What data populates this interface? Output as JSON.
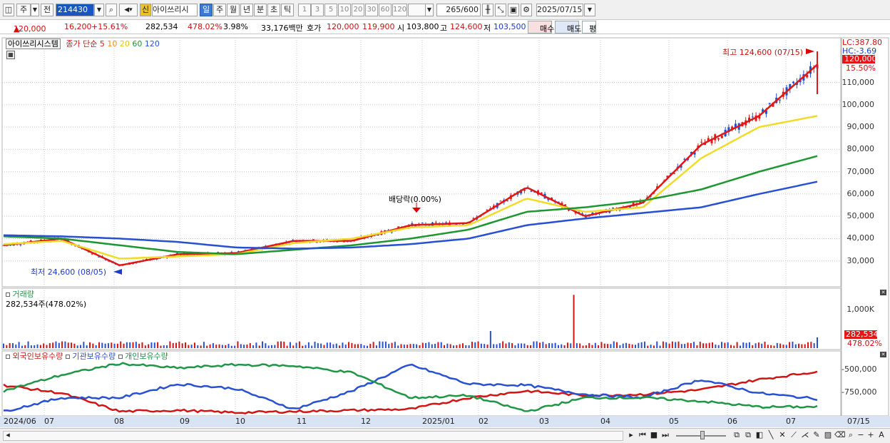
{
  "toolbar": {
    "market_label": "주",
    "prev_label": "전",
    "stock_code": "214430",
    "new_badge": "신",
    "stock_name": "아이쓰리시",
    "period_buttons": [
      "일",
      "주",
      "월",
      "년",
      "분",
      "초",
      "틱"
    ],
    "active_period": "일",
    "interval_numbers": [
      "1",
      "3",
      "5",
      "10",
      "20",
      "30",
      "60",
      "120"
    ],
    "count_value": "265",
    "count_max": "/600",
    "date_value": "2025/07/15"
  },
  "info": {
    "price": "120,000",
    "change_arrow": "▲",
    "change": "16,200",
    "change_pct": "+15.61%",
    "volume": "282,534",
    "volume_ratio": "478.02%",
    "turnover": "3.98%",
    "amount": "33,176백만",
    "bid_label": "호가",
    "bid1": "120,000",
    "bid2": "119,900",
    "open_label": "시",
    "open": "103,800",
    "high_label": "고",
    "high": "124,600",
    "low_label": "저",
    "low": "103,500",
    "buy_button": "매수",
    "sell_button": "매도",
    "eval_button": "평"
  },
  "price_panel": {
    "stock_tag": "아이쓰리시스템",
    "ma_label": "종가 단순",
    "ma_periods": [
      "5",
      "10",
      "20",
      "60",
      "120"
    ],
    "ma_colors": [
      "#e01818",
      "#f08c1e",
      "#f0dc28",
      "#1e9632",
      "#2850d2"
    ],
    "max_label": "최고 124,600 (07/15)",
    "min_label": "최저 24,600 (08/05)",
    "dividend_label": "배당락(0.00%)",
    "lc_label": "LC:387.80",
    "hc_label": "HC:-3.69",
    "current_price_tag": "120,000",
    "current_pct_tag": "15.50%",
    "y_ticks": [
      "110,000",
      "100,000",
      "90,000",
      "80,000",
      "70,000",
      "60,000",
      "50,000",
      "40,000",
      "30,000"
    ]
  },
  "volume_panel": {
    "title": "거래량",
    "value_label": "282,534주(478.02%)",
    "y_tick": "1,000K",
    "current_tag": "282,534",
    "current_pct": "478.02%"
  },
  "holdings_panel": {
    "series_labels": [
      "외국인보유수량",
      "기관보유수량",
      "개인보유수량"
    ],
    "series_colors": [
      "#d21414",
      "#2850d2",
      "#1e9646"
    ],
    "y_ticks": [
      "-500,000",
      "-750,000"
    ]
  },
  "x_axis": {
    "labels": [
      "2024/06",
      "07",
      "08",
      "09",
      "10",
      "11",
      "12",
      "2025/01",
      "02",
      "03",
      "04",
      "05",
      "06",
      "07",
      "07/15"
    ]
  },
  "chart_data": {
    "type": "line",
    "title": "",
    "x": [
      "2024/06",
      "2024/07",
      "2024/08",
      "2024/09",
      "2024/10",
      "2024/11",
      "2024/12",
      "2025/01",
      "2025/02",
      "2025/03",
      "2025/04",
      "2025/05",
      "2025/06",
      "2025/07",
      "2025/07/15"
    ],
    "series": [
      {
        "name": "5",
        "values": [
          37000,
          40000,
          28000,
          33000,
          33500,
          39000,
          39000,
          46000,
          47000,
          63000,
          50000,
          56000,
          82000,
          95000,
          118000
        ]
      },
      {
        "name": "20",
        "values": [
          37500,
          39000,
          31000,
          32000,
          33000,
          38000,
          40000,
          45000,
          46000,
          58000,
          52000,
          54000,
          76000,
          90000,
          95000
        ]
      },
      {
        "name": "60",
        "values": [
          41000,
          40000,
          37000,
          34000,
          33000,
          35000,
          37000,
          40000,
          44000,
          52000,
          54000,
          57000,
          62000,
          70000,
          77000
        ]
      },
      {
        "name": "120",
        "values": [
          41500,
          41000,
          40000,
          38500,
          36000,
          35500,
          36000,
          37500,
          40000,
          46000,
          49000,
          51500,
          54000,
          60000,
          65500
        ]
      }
    ],
    "ylim": [
      20000,
      130000
    ],
    "volume_ylim": [
      0,
      1500000
    ],
    "holdings_ylim": [
      -900000,
      -400000
    ]
  }
}
